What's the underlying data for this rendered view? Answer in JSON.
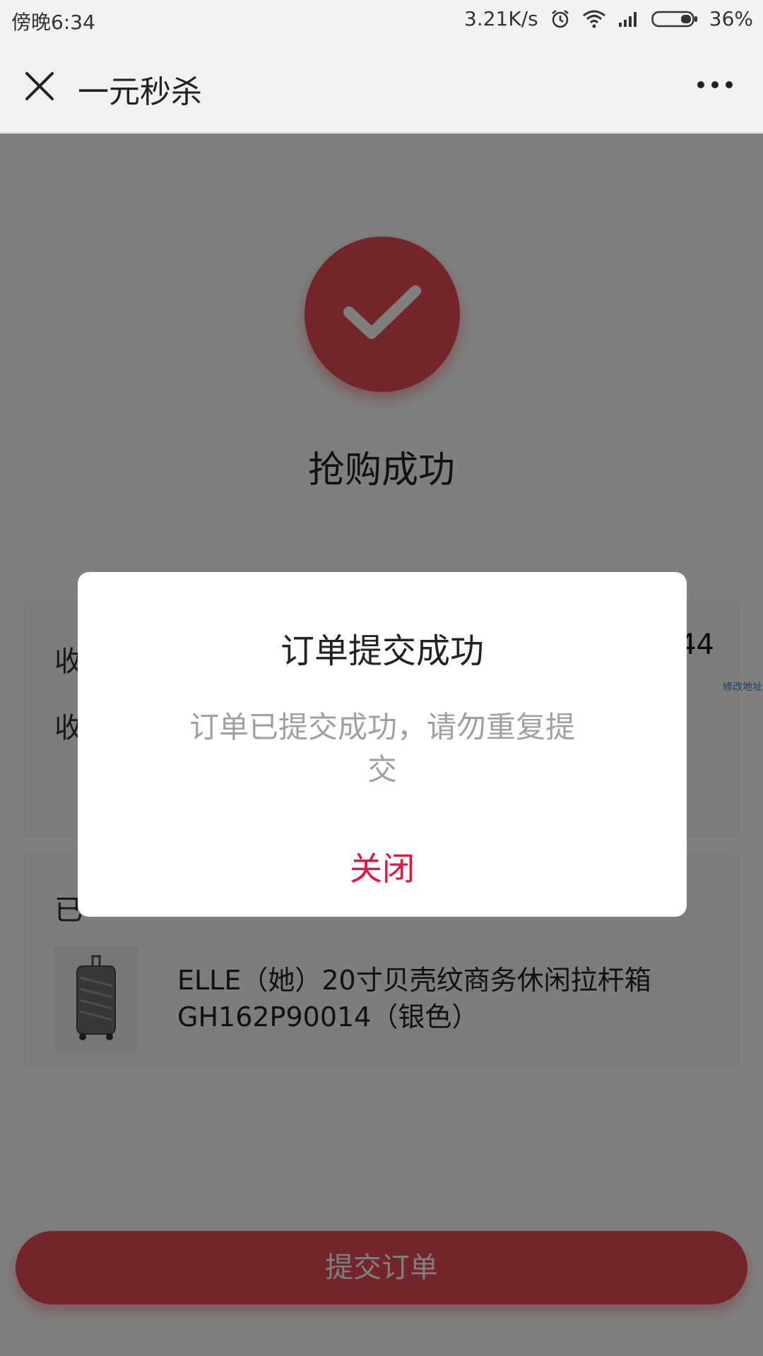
{
  "status_bar": {
    "time": "傍晚6:34",
    "network_speed": "3.21K/s",
    "battery": "36%",
    "icons": [
      "alarm-icon",
      "wifi-icon",
      "signal-icon",
      "battery-icon"
    ]
  },
  "nav": {
    "title": "一元秒杀",
    "close_icon": "close-icon",
    "more_icon": "more-icon"
  },
  "page": {
    "success_icon": "check-icon",
    "success_title": "抢购成功",
    "address_card": {
      "label_1": "收",
      "label_2": "收",
      "phone_tail": "44",
      "edit_link": "修改地址"
    },
    "goods_card": {
      "header": "已",
      "product_name_line1": "ELLE（她）20寸贝壳纹商务休闲拉杆箱",
      "product_name_line2": "GH162P90014（银色）",
      "thumbnail_icon": "suitcase-icon"
    },
    "submit_label": "提交订单"
  },
  "dialog": {
    "title": "订单提交成功",
    "message": "订单已提交成功，请勿重复提交",
    "close_label": "关闭"
  },
  "colors": {
    "accent_red": "#e84a52",
    "dialog_close_red": "#e5163d",
    "overlay": "rgba(0,0,0,0.5)"
  }
}
